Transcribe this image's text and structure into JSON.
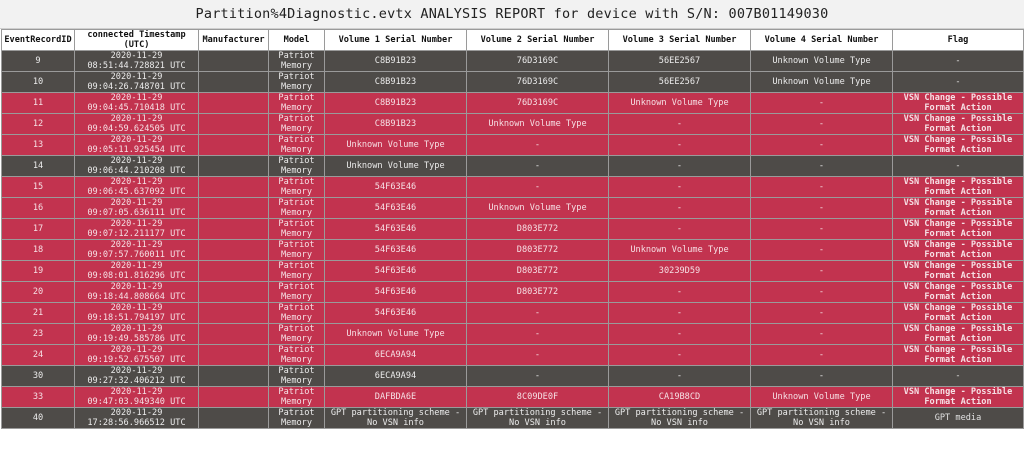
{
  "title": "Partition%4Diagnostic.evtx ANALYSIS REPORT for device with S/N: 007B01149030",
  "columns": [
    "EventRecordID",
    "connected Timestamp (UTC)",
    "Manufacturer",
    "Model",
    "Volume 1 Serial Number",
    "Volume 2 Serial Number",
    "Volume 3 Serial Number",
    "Volume 4 Serial Number",
    "Flag"
  ],
  "rows": [
    {
      "id": "9",
      "date": "2020-11-29",
      "time": "08:51:44.728821 UTC",
      "manufacturer": "",
      "model1": "Patriot",
      "model2": "Memory",
      "v1": "C8B91B23",
      "v2": "76D3169C",
      "v3": "56EE2567",
      "v4": "Unknown Volume Type",
      "flag1": "-",
      "flag2": "",
      "highlight": false
    },
    {
      "id": "10",
      "date": "2020-11-29",
      "time": "09:04:26.748701 UTC",
      "manufacturer": "",
      "model1": "Patriot",
      "model2": "Memory",
      "v1": "C8B91B23",
      "v2": "76D3169C",
      "v3": "56EE2567",
      "v4": "Unknown Volume Type",
      "flag1": "-",
      "flag2": "",
      "highlight": false
    },
    {
      "id": "11",
      "date": "2020-11-29",
      "time": "09:04:45.710418 UTC",
      "manufacturer": "",
      "model1": "Patriot",
      "model2": "Memory",
      "v1": "C8B91B23",
      "v2": "76D3169C",
      "v3": "Unknown Volume Type",
      "v4": "-",
      "flag1": "VSN Change - Possible",
      "flag2": "Format Action",
      "highlight": true
    },
    {
      "id": "12",
      "date": "2020-11-29",
      "time": "09:04:59.624505 UTC",
      "manufacturer": "",
      "model1": "Patriot",
      "model2": "Memory",
      "v1": "C8B91B23",
      "v2": "Unknown Volume Type",
      "v3": "-",
      "v4": "-",
      "flag1": "VSN Change - Possible",
      "flag2": "Format Action",
      "highlight": true
    },
    {
      "id": "13",
      "date": "2020-11-29",
      "time": "09:05:11.925454 UTC",
      "manufacturer": "",
      "model1": "Patriot",
      "model2": "Memory",
      "v1": "Unknown Volume Type",
      "v2": "-",
      "v3": "-",
      "v4": "-",
      "flag1": "VSN Change - Possible",
      "flag2": "Format Action",
      "highlight": true
    },
    {
      "id": "14",
      "date": "2020-11-29",
      "time": "09:06:44.210208 UTC",
      "manufacturer": "",
      "model1": "Patriot",
      "model2": "Memory",
      "v1": "Unknown Volume Type",
      "v2": "-",
      "v3": "-",
      "v4": "-",
      "flag1": "-",
      "flag2": "",
      "highlight": false
    },
    {
      "id": "15",
      "date": "2020-11-29",
      "time": "09:06:45.637092 UTC",
      "manufacturer": "",
      "model1": "Patriot",
      "model2": "Memory",
      "v1": "54F63E46",
      "v2": "-",
      "v3": "-",
      "v4": "-",
      "flag1": "VSN Change - Possible",
      "flag2": "Format Action",
      "highlight": true
    },
    {
      "id": "16",
      "date": "2020-11-29",
      "time": "09:07:05.636111 UTC",
      "manufacturer": "",
      "model1": "Patriot",
      "model2": "Memory",
      "v1": "54F63E46",
      "v2": "Unknown Volume Type",
      "v3": "-",
      "v4": "-",
      "flag1": "VSN Change - Possible",
      "flag2": "Format Action",
      "highlight": true
    },
    {
      "id": "17",
      "date": "2020-11-29",
      "time": "09:07:12.211177 UTC",
      "manufacturer": "",
      "model1": "Patriot",
      "model2": "Memory",
      "v1": "54F63E46",
      "v2": "D803E772",
      "v3": "-",
      "v4": "-",
      "flag1": "VSN Change - Possible",
      "flag2": "Format Action",
      "highlight": true
    },
    {
      "id": "18",
      "date": "2020-11-29",
      "time": "09:07:57.760011 UTC",
      "manufacturer": "",
      "model1": "Patriot",
      "model2": "Memory",
      "v1": "54F63E46",
      "v2": "D803E772",
      "v3": "Unknown Volume Type",
      "v4": "-",
      "flag1": "VSN Change - Possible",
      "flag2": "Format Action",
      "highlight": true
    },
    {
      "id": "19",
      "date": "2020-11-29",
      "time": "09:08:01.816296 UTC",
      "manufacturer": "",
      "model1": "Patriot",
      "model2": "Memory",
      "v1": "54F63E46",
      "v2": "D803E772",
      "v3": "30239D59",
      "v4": "-",
      "flag1": "VSN Change - Possible",
      "flag2": "Format Action",
      "highlight": true
    },
    {
      "id": "20",
      "date": "2020-11-29",
      "time": "09:18:44.808664 UTC",
      "manufacturer": "",
      "model1": "Patriot",
      "model2": "Memory",
      "v1": "54F63E46",
      "v2": "D803E772",
      "v3": "-",
      "v4": "-",
      "flag1": "VSN Change - Possible",
      "flag2": "Format Action",
      "highlight": true
    },
    {
      "id": "21",
      "date": "2020-11-29",
      "time": "09:18:51.794197 UTC",
      "manufacturer": "",
      "model1": "Patriot",
      "model2": "Memory",
      "v1": "54F63E46",
      "v2": "-",
      "v3": "-",
      "v4": "-",
      "flag1": "VSN Change - Possible",
      "flag2": "Format Action",
      "highlight": true
    },
    {
      "id": "23",
      "date": "2020-11-29",
      "time": "09:19:49.585786 UTC",
      "manufacturer": "",
      "model1": "Patriot",
      "model2": "Memory",
      "v1": "Unknown Volume Type",
      "v2": "-",
      "v3": "-",
      "v4": "-",
      "flag1": "VSN Change - Possible",
      "flag2": "Format Action",
      "highlight": true
    },
    {
      "id": "24",
      "date": "2020-11-29",
      "time": "09:19:52.675507 UTC",
      "manufacturer": "",
      "model1": "Patriot",
      "model2": "Memory",
      "v1": "6ECA9A94",
      "v2": "-",
      "v3": "-",
      "v4": "-",
      "flag1": "VSN Change - Possible",
      "flag2": "Format Action",
      "highlight": true
    },
    {
      "id": "30",
      "date": "2020-11-29",
      "time": "09:27:32.406212 UTC",
      "manufacturer": "",
      "model1": "Patriot",
      "model2": "Memory",
      "v1": "6ECA9A94",
      "v2": "-",
      "v3": "-",
      "v4": "-",
      "flag1": "-",
      "flag2": "",
      "highlight": false
    },
    {
      "id": "33",
      "date": "2020-11-29",
      "time": "09:47:03.949340 UTC",
      "manufacturer": "",
      "model1": "Patriot",
      "model2": "Memory",
      "v1": "DAFBDA6E",
      "v2": "8C09DE0F",
      "v3": "CA19B8CD",
      "v4": "Unknown Volume Type",
      "flag1": "VSN Change - Possible",
      "flag2": "Format Action",
      "highlight": true
    },
    {
      "id": "40",
      "date": "2020-11-29",
      "time": "17:28:56.966512 UTC",
      "manufacturer": "",
      "model1": "Patriot",
      "model2": "Memory",
      "v1": "GPT partitioning scheme - No VSN info",
      "v2": "GPT partitioning scheme - No VSN info",
      "v3": "GPT partitioning scheme - No VSN info",
      "v4": "GPT partitioning scheme - No VSN info",
      "flag1": "GPT media",
      "flag2": "",
      "highlight": false
    }
  ],
  "colors": {
    "normal_row": "#4e4b48",
    "highlight_row": "#c2334f",
    "header_bg": "#ffffff"
  }
}
